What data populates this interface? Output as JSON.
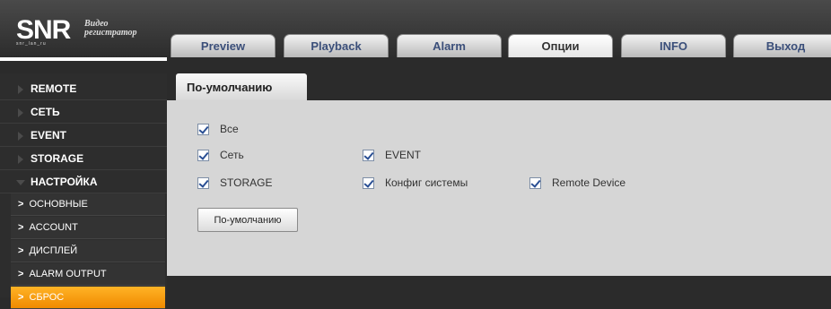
{
  "logo": {
    "text": "SNR",
    "caption_line1": "Видео",
    "caption_line2": "регистратор",
    "small": "snr_lan_ru"
  },
  "tabs": [
    {
      "label": "Preview"
    },
    {
      "label": "Playback"
    },
    {
      "label": "Alarm"
    },
    {
      "label": "Опции"
    },
    {
      "label": "INFO"
    },
    {
      "label": "Выход"
    }
  ],
  "active_tab": "Опции",
  "sidebar": {
    "items": [
      {
        "label": "REMOTE"
      },
      {
        "label": "СЕТЬ"
      },
      {
        "label": "EVENT"
      },
      {
        "label": "STORAGE"
      },
      {
        "label": "НАСТРОЙКА"
      }
    ],
    "subitems": [
      {
        "label": "ОСНОВНЫЕ"
      },
      {
        "label": "ACCOUNT"
      },
      {
        "label": "ДИСПЛЕЙ"
      },
      {
        "label": "ALARM OUTPUT"
      },
      {
        "label": "СБРОС"
      }
    ]
  },
  "panel": {
    "title": "По-умолчанию",
    "checkboxes": {
      "all": {
        "label": "Все",
        "checked": true
      },
      "network": {
        "label": "Сеть",
        "checked": true
      },
      "event": {
        "label": "EVENT",
        "checked": true
      },
      "storage": {
        "label": "STORAGE",
        "checked": true
      },
      "system": {
        "label": "Конфиг системы",
        "checked": true
      },
      "remote": {
        "label": "Remote Device",
        "checked": true
      }
    },
    "default_button": "По-умолчанию"
  },
  "colors": {
    "active_accent": "#f39a12",
    "background": "#2b2b2b",
    "content_bg": "#d6d6d6"
  }
}
